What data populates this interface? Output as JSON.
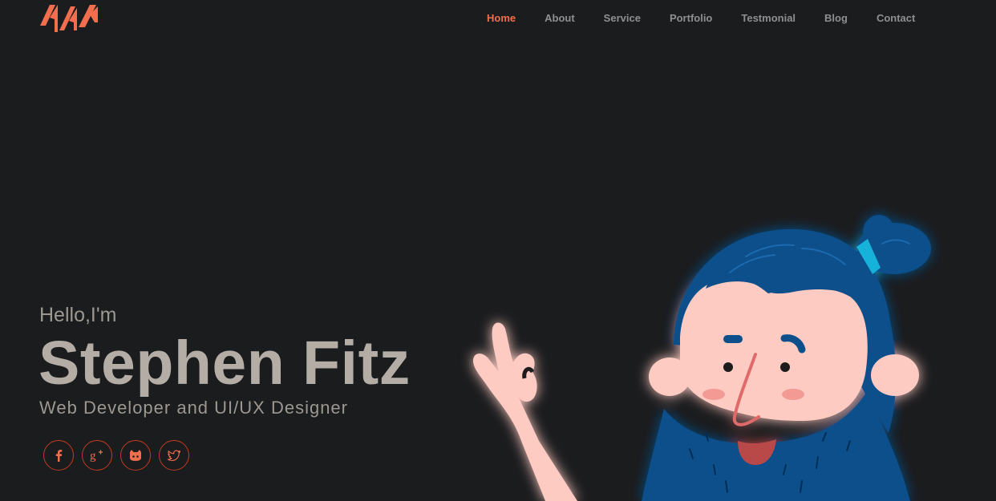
{
  "header": {
    "logo_icon": "brand-logo-icon",
    "nav": [
      {
        "label": "Home",
        "active": true
      },
      {
        "label": "About",
        "active": false
      },
      {
        "label": "Service",
        "active": false
      },
      {
        "label": "Portfolio",
        "active": false
      },
      {
        "label": "Testmonial",
        "active": false
      },
      {
        "label": "Blog",
        "active": false
      },
      {
        "label": "Contact",
        "active": false
      }
    ]
  },
  "hero": {
    "greeting": "Hello,I'm",
    "name": "Stephen Fitz",
    "role": "Web Developer and UI/UX Designer",
    "socials": [
      {
        "icon": "facebook-icon"
      },
      {
        "icon": "google-plus-icon"
      },
      {
        "icon": "github-icon"
      },
      {
        "icon": "twitter-icon"
      }
    ],
    "illustration_icon": "bearded-man-ok-hand-illustration"
  },
  "colors": {
    "background": "#1b1c1e",
    "accent": "#f36e4f",
    "nav_text": "#8f8f8f",
    "name_text": "#b3ada5",
    "social_border": "#c23b22",
    "hair_blue": "#0b4f8a",
    "skin": "#fecbc3"
  }
}
